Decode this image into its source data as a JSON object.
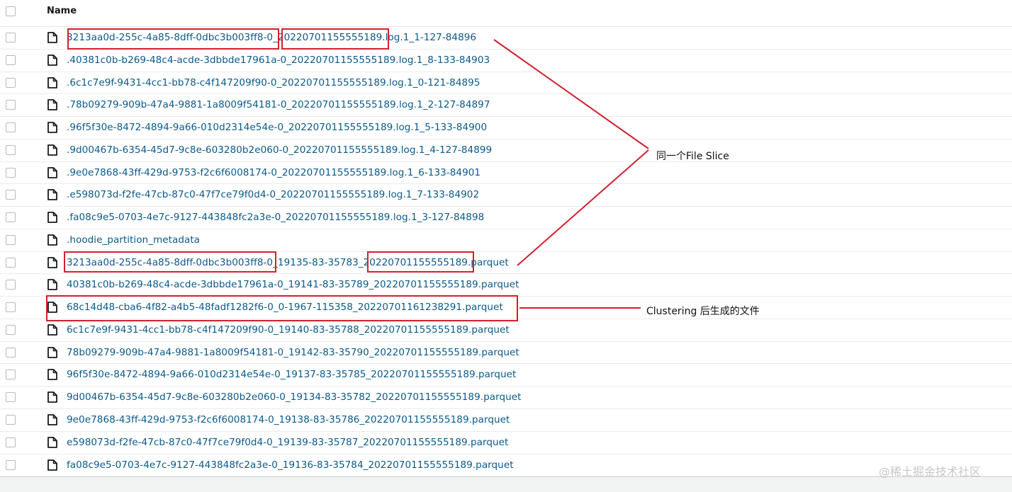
{
  "header": {
    "name_label": "Name"
  },
  "files": [
    "3213aa0d-255c-4a85-8dff-0dbc3b003ff8-0_20220701155555189.log.1_1-127-84896",
    ".40381c0b-b269-48c4-acde-3dbbde17961a-0_20220701155555189.log.1_8-133-84903",
    ".6c1c7e9f-9431-4cc1-bb78-c4f147209f90-0_20220701155555189.log.1_0-121-84895",
    ".78b09279-909b-47a4-9881-1a8009f54181-0_20220701155555189.log.1_2-127-84897",
    ".96f5f30e-8472-4894-9a66-010d2314e54e-0_20220701155555189.log.1_5-133-84900",
    ".9d00467b-6354-45d7-9c8e-603280b2e060-0_20220701155555189.log.1_4-127-84899",
    ".9e0e7868-43ff-429d-9753-f2c6f6008174-0_20220701155555189.log.1_6-133-84901",
    ".e598073d-f2fe-47cb-87c0-47f7ce79f0d4-0_20220701155555189.log.1_7-133-84902",
    ".fa08c9e5-0703-4e7c-9127-443848fc2a3e-0_20220701155555189.log.1_3-127-84898",
    ".hoodie_partition_metadata",
    "3213aa0d-255c-4a85-8dff-0dbc3b003ff8-0_19135-83-35783_20220701155555189.parquet",
    "40381c0b-b269-48c4-acde-3dbbde17961a-0_19141-83-35789_20220701155555189.parquet",
    "68c14d48-cba6-4f82-a4b5-48fadf1282f6-0_0-1967-115358_20220701161238291.parquet",
    "6c1c7e9f-9431-4cc1-bb78-c4f147209f90-0_19140-83-35788_20220701155555189.parquet",
    "78b09279-909b-47a4-9881-1a8009f54181-0_19142-83-35790_20220701155555189.parquet",
    "96f5f30e-8472-4894-9a66-010d2314e54e-0_19137-83-35785_20220701155555189.parquet",
    "9d00467b-6354-45d7-9c8e-603280b2e060-0_19134-83-35782_20220701155555189.parquet",
    "9e0e7868-43ff-429d-9753-f2c6f6008174-0_19138-83-35786_20220701155555189.parquet",
    "e598073d-f2fe-47cb-87c0-47f7ce79f0d4-0_19139-83-35787_20220701155555189.parquet",
    "fa08c9e5-0703-4e7c-9127-443848fc2a3e-0_19136-83-35784_20220701155555189.parquet"
  ],
  "annotations": {
    "file_slice_label": "同一个File Slice",
    "clustering_label": "Clustering 后生成的文件"
  },
  "watermark": "@稀土掘金技术社区",
  "colors": {
    "link": "#0a5a8a",
    "highlight": "#d21f2d"
  },
  "icons": {
    "row_icon": "file-icon",
    "row_checkbox": "checkbox"
  }
}
